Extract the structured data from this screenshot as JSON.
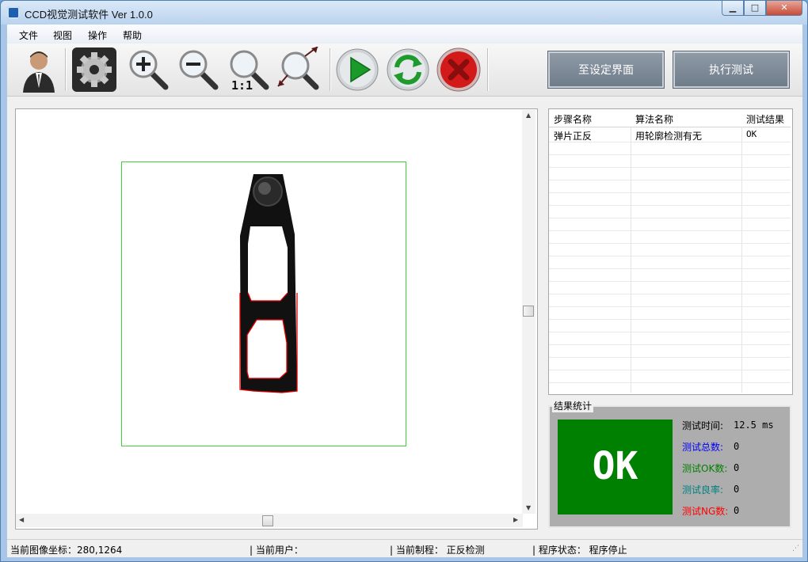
{
  "window": {
    "title": "CCD视觉测试软件 Ver 1.0.0",
    "min_glyph": "▁",
    "max_glyph": "□",
    "close_glyph": "✕"
  },
  "menu": [
    "文件",
    "视图",
    "操作",
    "帮助"
  ],
  "toolbar": {
    "zoom_1to1_label": "1:1",
    "to_settings_label": "至设定界面",
    "run_test_label": "执行测试"
  },
  "results_table": {
    "columns": [
      "步骤名称",
      "算法名称",
      "测试结果"
    ],
    "rows": [
      [
        "弹片正反",
        "用轮廓检测有无",
        "OK"
      ]
    ]
  },
  "stats": {
    "legend": "结果统计",
    "result": "OK",
    "result_color": "#008000",
    "test_time_label": "测试时间:",
    "test_time_value": "12.5 ms",
    "total_label": "测试总数:",
    "total_value": "0",
    "ok_count_label": "测试OK数:",
    "ok_count_value": "0",
    "yield_label": "测试良率:",
    "yield_value": "0",
    "ng_count_label": "测试NG数:",
    "ng_count_value": "0",
    "colors": {
      "total": "#0000ff",
      "ok": "#008000",
      "yield": "#008080",
      "ng": "#ff0000"
    }
  },
  "status": {
    "coords": "当前图像坐标：280,1264",
    "user": "|  当前用户：",
    "process": "|  当前制程：   正反检测",
    "state": "|  程序状态：   程序停止"
  }
}
